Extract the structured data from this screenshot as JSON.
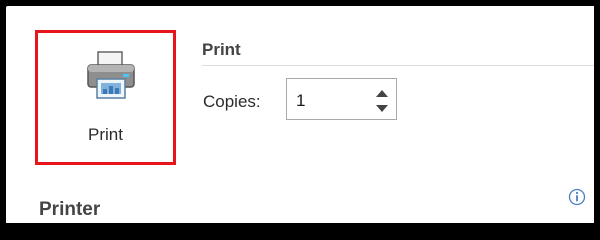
{
  "print_tile": {
    "label": "Print",
    "icon": "printer-icon",
    "highlight_color": "#e8141c"
  },
  "print_section": {
    "title": "Print"
  },
  "copies": {
    "label": "Copies:",
    "value": "1"
  },
  "printer_section": {
    "heading": "Printer",
    "info_icon": "info-icon"
  }
}
